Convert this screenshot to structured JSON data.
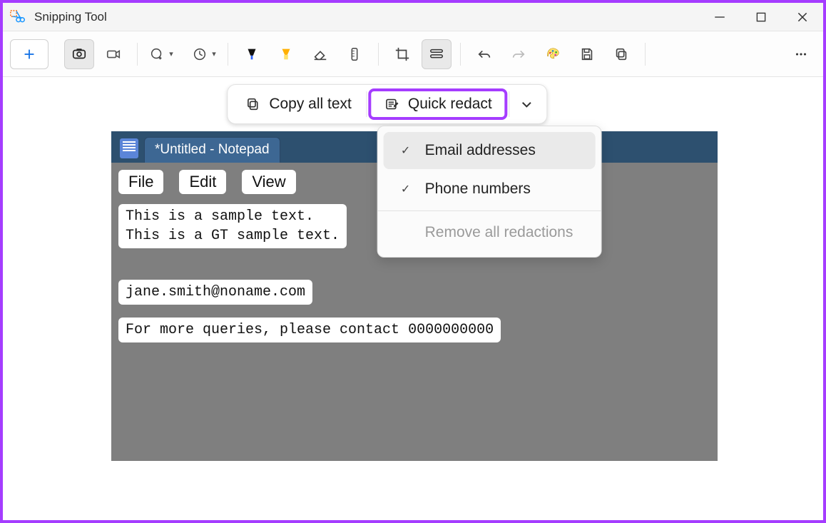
{
  "app": {
    "title": "Snipping Tool"
  },
  "window_controls": {
    "minimize": "—",
    "maximize": "▢",
    "close": "✕"
  },
  "text_actions": {
    "copy_all": "Copy all text",
    "quick_redact": "Quick redact",
    "menu": {
      "email": "Email addresses",
      "phone": "Phone numbers",
      "remove": "Remove all redactions"
    }
  },
  "captured": {
    "tab_title": "*Untitled - Notepad",
    "menus": {
      "file": "File",
      "edit": "Edit",
      "view": "View"
    },
    "block1_line1": "This is a sample text.",
    "block1_line2": "This is a GT sample text.",
    "block2": "jane.smith@noname.com",
    "block3": "For more queries, please contact 0000000000"
  }
}
